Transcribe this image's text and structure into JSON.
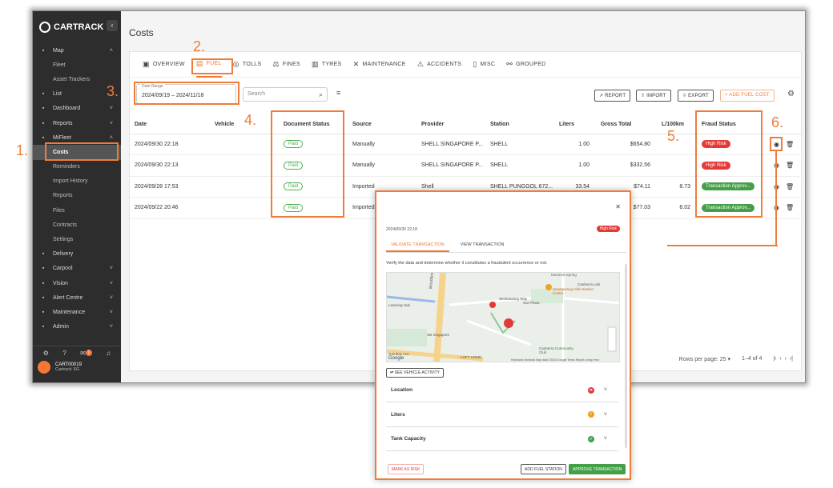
{
  "app": {
    "brand": "CARTRACK",
    "page_title": "Costs"
  },
  "sidebar": {
    "items": [
      {
        "label": "Map",
        "icon": "map-icon",
        "chevron": "˄"
      },
      {
        "label": "Fleet",
        "sub": true
      },
      {
        "label": "Asset Trackers",
        "sub": true
      },
      {
        "label": "List",
        "icon": "list-icon"
      },
      {
        "label": "Dashboard",
        "icon": "dashboard-icon",
        "chevron": "˅"
      },
      {
        "label": "Reports",
        "icon": "reports-icon",
        "chevron": "˅"
      },
      {
        "label": "MiFleet",
        "icon": "dollar-icon",
        "chevron": "˄"
      },
      {
        "label": "Costs",
        "sub": true,
        "active": true
      },
      {
        "label": "Reminders",
        "sub": true
      },
      {
        "label": "Import History",
        "sub": true
      },
      {
        "label": "Reports",
        "sub": true
      },
      {
        "label": "Files",
        "sub": true
      },
      {
        "label": "Contracts",
        "sub": true
      },
      {
        "label": "Settings",
        "sub": true
      },
      {
        "label": "Delivery",
        "icon": "delivery-icon"
      },
      {
        "label": "Carpool",
        "icon": "carpool-icon",
        "chevron": "˅"
      },
      {
        "label": "Vision",
        "icon": "vision-icon",
        "chevron": "˅"
      },
      {
        "label": "Alert Centre",
        "icon": "alert-centre-icon",
        "chevron": "˅"
      },
      {
        "label": "Maintenance",
        "icon": "maintenance-icon",
        "chevron": "˅"
      },
      {
        "label": "Admin",
        "icon": "admin-icon",
        "chevron": "˅"
      }
    ],
    "notification_count": "1",
    "account": {
      "id": "CART00019",
      "name": "Cartrack SG"
    }
  },
  "tabs": [
    "OVERVIEW",
    "FUEL",
    "TOLLS",
    "FINES",
    "TYRES",
    "MAINTENANCE",
    "ACCIDENTS",
    "MISC",
    "GROUPED"
  ],
  "toolbar": {
    "date_label": "Date Range",
    "date_value": "2024/09/19 – 2024/11/18",
    "search_placeholder": "Search",
    "report": "REPORT",
    "import": "IMPORT",
    "export": "EXPORT",
    "add": "ADD FUEL COST"
  },
  "table": {
    "headers": [
      "Date",
      "Vehicle",
      "Document Status",
      "Source",
      "Provider",
      "Station",
      "Liters",
      "Gross Total",
      "L/100km",
      "Fraud Status"
    ],
    "rows": [
      {
        "date": "2024/09/30 22:18",
        "vehicle": "",
        "doc": "Paid",
        "source": "Manually",
        "provider": "SHELL SINGAPORE P...",
        "station": "SHELL",
        "liters": "1.00",
        "gross": "$654.80",
        "l100": "",
        "fraud": "High Risk",
        "risk": true
      },
      {
        "date": "2024/09/30 22:13",
        "vehicle": "",
        "doc": "Paid",
        "source": "Manually",
        "provider": "SHELL SINGAPORE P...",
        "station": "SHELL",
        "liters": "1.00",
        "gross": "$332.56",
        "l100": "",
        "fraud": "High Risk",
        "risk": true
      },
      {
        "date": "2024/09/28 17:53",
        "vehicle": "",
        "doc": "Paid",
        "source": "Imported",
        "provider": "Shell",
        "station": "SHELL PUNGGOL 672...",
        "liters": "33.54",
        "gross": "$74.11",
        "l100": "8.73",
        "fraud": "Transaction Approv...",
        "risk": false
      },
      {
        "date": "2024/09/22 20:46",
        "vehicle": "",
        "doc": "Paid",
        "source": "Imported",
        "provider": "",
        "station": "",
        "liters": "",
        "gross": "$77.03",
        "l100": "8.02",
        "fraud": "Transaction Approv...",
        "risk": false
      }
    ]
  },
  "pagination": {
    "rows_label": "Rows per page:",
    "rows_value": "25",
    "range": "1–4 of 4"
  },
  "annotations": [
    "1.",
    "2.",
    "3.",
    "4.",
    "5.",
    "6."
  ],
  "modal": {
    "date": "2024/09/30 22:18",
    "risk": "High Risk",
    "tab_validate": "VALIDATE TRANSACTION",
    "tab_view": "VIEW TRANSACTION",
    "description": "Verify the data and determine whether it constitutes a fraudulent occurrence or not.",
    "map_labels": {
      "road": "Woodlands Ave 10",
      "canberra_link": "Canberra Link",
      "hawker": "Sembawang Hills Hawker Centre",
      "sun_plaza": "Sun Plaza",
      "sembawang_way": "Sembawang Way",
      "sm_singapore": "3M Singapore",
      "community_club": "Canberra Community Club",
      "loft_home": "LOFT HOME",
      "google": "Google",
      "footer": "Keyboard shortcuts  Map data ©2024 Google  Terms  Report a map error",
      "learning_hub": "Learning Hub",
      "gambas": "Gambas Ave",
      "montreal": "Montreal Spring"
    },
    "vehicle_btn": "SEE VEHICLE ACTIVITY",
    "checks": [
      {
        "label": "Location",
        "status": "fail"
      },
      {
        "label": "Liters",
        "status": "warn"
      },
      {
        "label": "Tank Capacity",
        "status": "ok"
      }
    ],
    "btn_risk": "MARK AS RISK",
    "btn_station": "ADD FUEL STATION",
    "btn_approve": "APPROVE TRANSACTION"
  },
  "colors": {
    "accent": "#f47735",
    "risk": "#e53935",
    "ok": "#43a047",
    "sidebar": "#2d2d2d"
  }
}
